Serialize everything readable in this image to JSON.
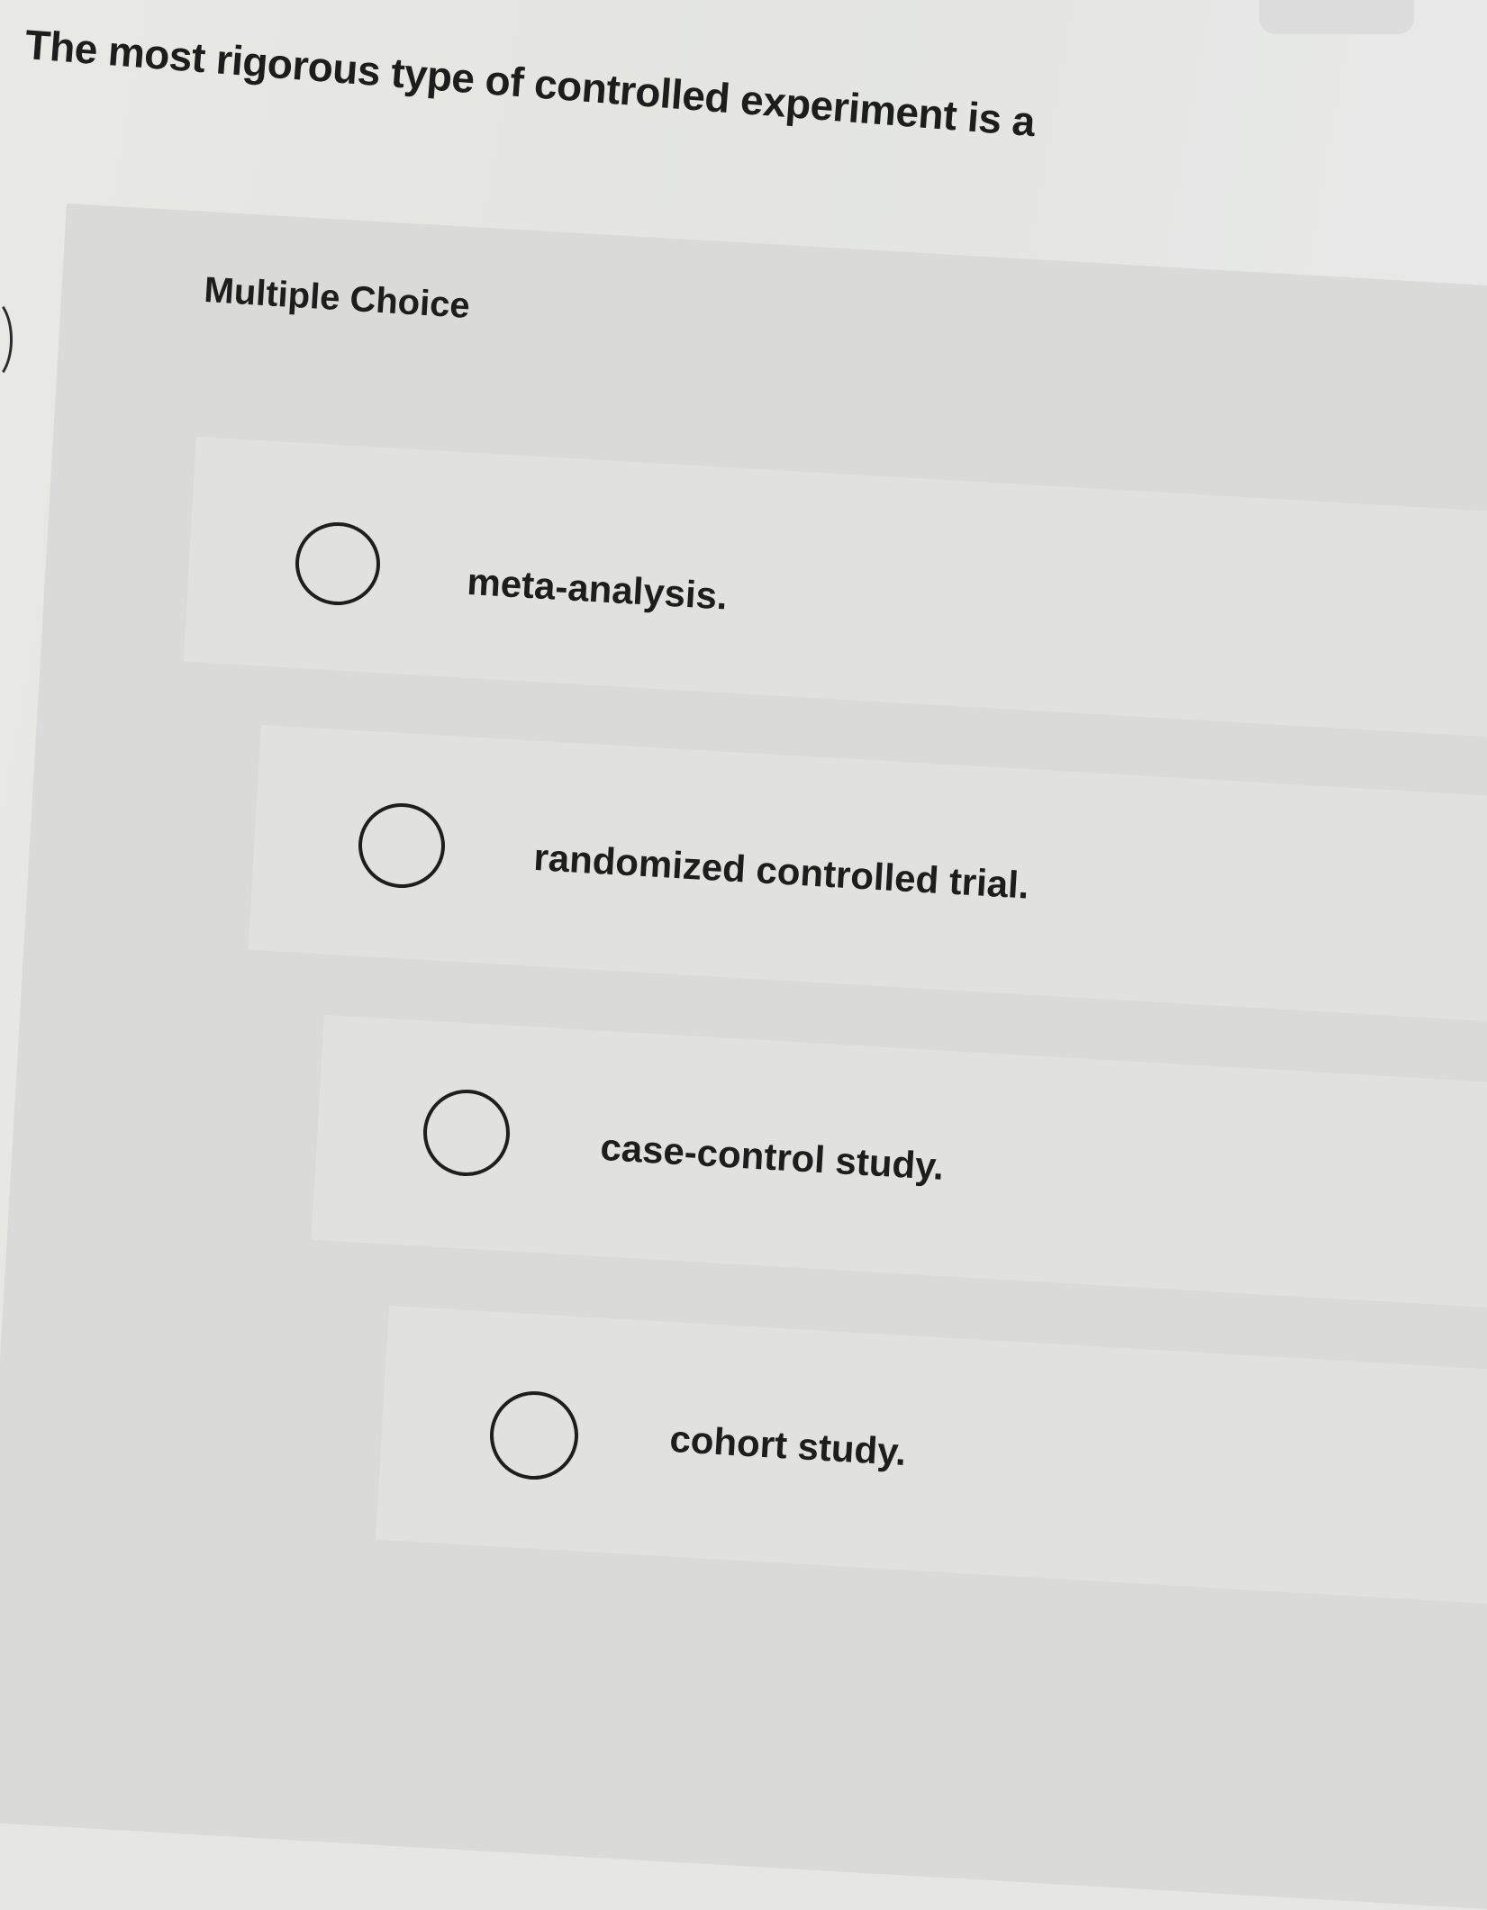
{
  "question": {
    "text": "The most rigorous type of controlled experiment is a"
  },
  "question_type": "Multiple Choice",
  "choices": [
    {
      "label": "meta-analysis.",
      "selected": false
    },
    {
      "label": "randomized controlled trial.",
      "selected": false
    },
    {
      "label": "case-control study.",
      "selected": false
    },
    {
      "label": "cohort study.",
      "selected": false
    }
  ]
}
